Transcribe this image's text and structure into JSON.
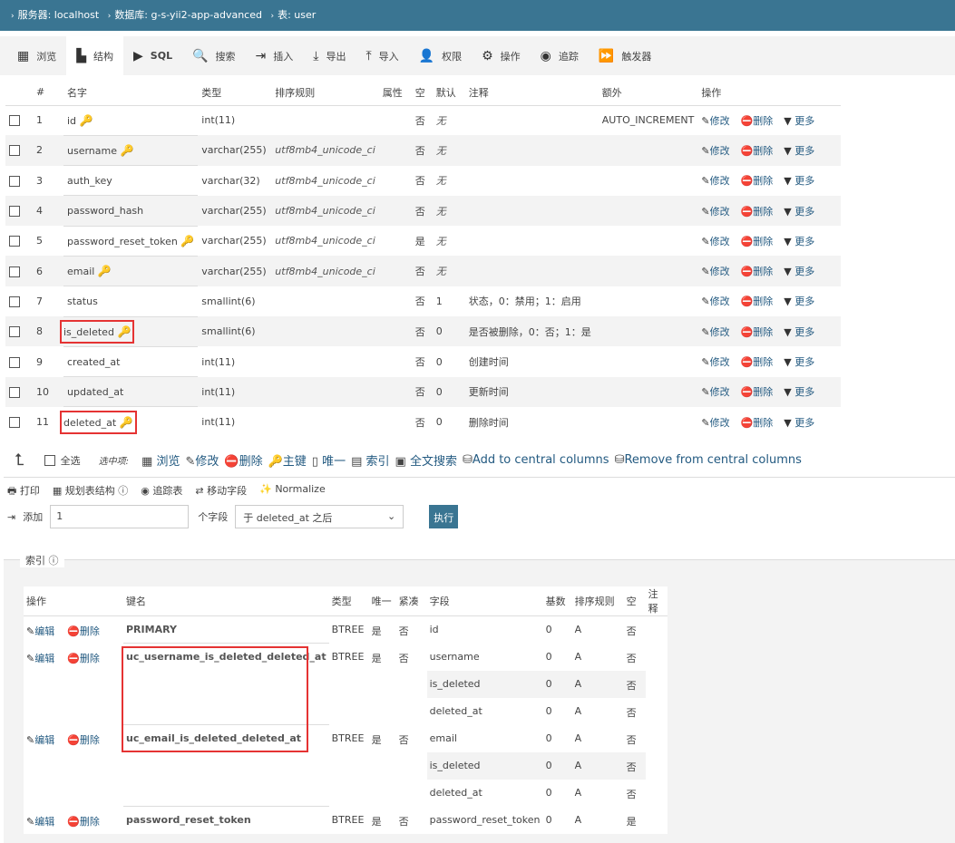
{
  "breadcrumb": {
    "server": "服务器: localhost",
    "database": "数据库: g-s-yii2-app-advanced",
    "table": "表: user"
  },
  "tabs": [
    {
      "label": "浏览",
      "icon": "browse-icon",
      "glyph": "▦"
    },
    {
      "label": "结构",
      "icon": "structure-icon",
      "glyph": "▙",
      "active": true
    },
    {
      "label": "SQL",
      "icon": "sql-icon",
      "glyph": "▶"
    },
    {
      "label": "搜索",
      "icon": "search-icon",
      "glyph": "🔍"
    },
    {
      "label": "插入",
      "icon": "insert-icon",
      "glyph": "⇥"
    },
    {
      "label": "导出",
      "icon": "export-icon",
      "glyph": "⤓"
    },
    {
      "label": "导入",
      "icon": "import-icon",
      "glyph": "⤒"
    },
    {
      "label": "权限",
      "icon": "user-icon",
      "glyph": "👤"
    },
    {
      "label": "操作",
      "icon": "gear-icon",
      "glyph": "⚙"
    },
    {
      "label": "追踪",
      "icon": "eye-icon",
      "glyph": "◉"
    },
    {
      "label": "触发器",
      "icon": "trigger-icon",
      "glyph": "⏩"
    }
  ],
  "columns": {
    "num": "#",
    "name": "名字",
    "type": "类型",
    "collation": "排序规则",
    "attributes": "属性",
    "null": "空",
    "default": "默认",
    "comment": "注释",
    "extra": "额外",
    "action": "操作"
  },
  "row_actions": {
    "change": "修改",
    "drop": "删除",
    "more": "更多"
  },
  "fields": [
    {
      "num": "1",
      "name": "id",
      "key": true,
      "type": "int(11)",
      "collation": "",
      "null": "否",
      "default": "无",
      "comment": "",
      "extra": "AUTO_INCREMENT"
    },
    {
      "num": "2",
      "name": "username",
      "key": true,
      "type": "varchar(255)",
      "collation": "utf8mb4_unicode_ci",
      "null": "否",
      "default": "无",
      "comment": "",
      "extra": ""
    },
    {
      "num": "3",
      "name": "auth_key",
      "key": false,
      "type": "varchar(32)",
      "collation": "utf8mb4_unicode_ci",
      "null": "否",
      "default": "无",
      "comment": "",
      "extra": ""
    },
    {
      "num": "4",
      "name": "password_hash",
      "key": false,
      "type": "varchar(255)",
      "collation": "utf8mb4_unicode_ci",
      "null": "否",
      "default": "无",
      "comment": "",
      "extra": ""
    },
    {
      "num": "5",
      "name": "password_reset_token",
      "key": true,
      "type": "varchar(255)",
      "collation": "utf8mb4_unicode_ci",
      "null": "是",
      "default": "无",
      "comment": "",
      "extra": ""
    },
    {
      "num": "6",
      "name": "email",
      "key": true,
      "type": "varchar(255)",
      "collation": "utf8mb4_unicode_ci",
      "null": "否",
      "default": "无",
      "comment": "",
      "extra": ""
    },
    {
      "num": "7",
      "name": "status",
      "key": false,
      "type": "smallint(6)",
      "collation": "",
      "null": "否",
      "default": "1",
      "comment": "状态，0：禁用；1：启用",
      "extra": ""
    },
    {
      "num": "8",
      "name": "is_deleted",
      "key": true,
      "highlight": true,
      "type": "smallint(6)",
      "collation": "",
      "null": "否",
      "default": "0",
      "comment": "是否被删除，0：否；1：是",
      "extra": ""
    },
    {
      "num": "9",
      "name": "created_at",
      "key": false,
      "type": "int(11)",
      "collation": "",
      "null": "否",
      "default": "0",
      "comment": "创建时间",
      "extra": ""
    },
    {
      "num": "10",
      "name": "updated_at",
      "key": false,
      "type": "int(11)",
      "collation": "",
      "null": "否",
      "default": "0",
      "comment": "更新时间",
      "extra": ""
    },
    {
      "num": "11",
      "name": "deleted_at",
      "key": true,
      "highlight": true,
      "type": "int(11)",
      "collation": "",
      "null": "否",
      "default": "0",
      "comment": "删除时间",
      "extra": ""
    }
  ],
  "selection": {
    "check_all": "全选",
    "with_selected": "选中项:",
    "browse": "浏览",
    "change": "修改",
    "drop": "删除",
    "primary": "主键",
    "unique": "唯一",
    "index": "索引",
    "fulltext": "全文搜索",
    "add_central": "Add to central columns",
    "remove_central": "Remove from central columns"
  },
  "tools": {
    "print": "打印",
    "propose": "规划表结构",
    "track": "追踪表",
    "move": "移动字段",
    "normalize": "Normalize"
  },
  "add_field": {
    "label": "添加",
    "count": "1",
    "unit": "个字段",
    "position": "于 deleted_at 之后",
    "go": "执行"
  },
  "indexes": {
    "legend": "索引",
    "headers": {
      "action": "操作",
      "keyname": "键名",
      "type": "类型",
      "unique": "唯一",
      "packed": "紧凑",
      "column": "字段",
      "cardinality": "基数",
      "collation": "排序规则",
      "null": "空",
      "comment": "注释"
    },
    "edit": "编辑",
    "drop": "删除",
    "rows": [
      {
        "keyname": "PRIMARY",
        "type": "BTREE",
        "unique": "是",
        "packed": "否",
        "cols": [
          {
            "column": "id",
            "cardinality": "0",
            "collation": "A",
            "null": "否"
          }
        ]
      },
      {
        "keyname": "uc_username_is_deleted_deleted_at",
        "type": "BTREE",
        "unique": "是",
        "packed": "否",
        "cols": [
          {
            "column": "username",
            "cardinality": "0",
            "collation": "A",
            "null": "否"
          },
          {
            "column": "is_deleted",
            "cardinality": "0",
            "collation": "A",
            "null": "否"
          },
          {
            "column": "deleted_at",
            "cardinality": "0",
            "collation": "A",
            "null": "否"
          }
        ]
      },
      {
        "keyname": "uc_email_is_deleted_deleted_at",
        "type": "BTREE",
        "unique": "是",
        "packed": "否",
        "cols": [
          {
            "column": "email",
            "cardinality": "0",
            "collation": "A",
            "null": "否"
          },
          {
            "column": "is_deleted",
            "cardinality": "0",
            "collation": "A",
            "null": "否"
          },
          {
            "column": "deleted_at",
            "cardinality": "0",
            "collation": "A",
            "null": "否"
          }
        ]
      },
      {
        "keyname": "password_reset_token",
        "type": "BTREE",
        "unique": "是",
        "packed": "否",
        "cols": [
          {
            "column": "password_reset_token",
            "cardinality": "0",
            "collation": "A",
            "null": "是"
          }
        ]
      }
    ]
  }
}
